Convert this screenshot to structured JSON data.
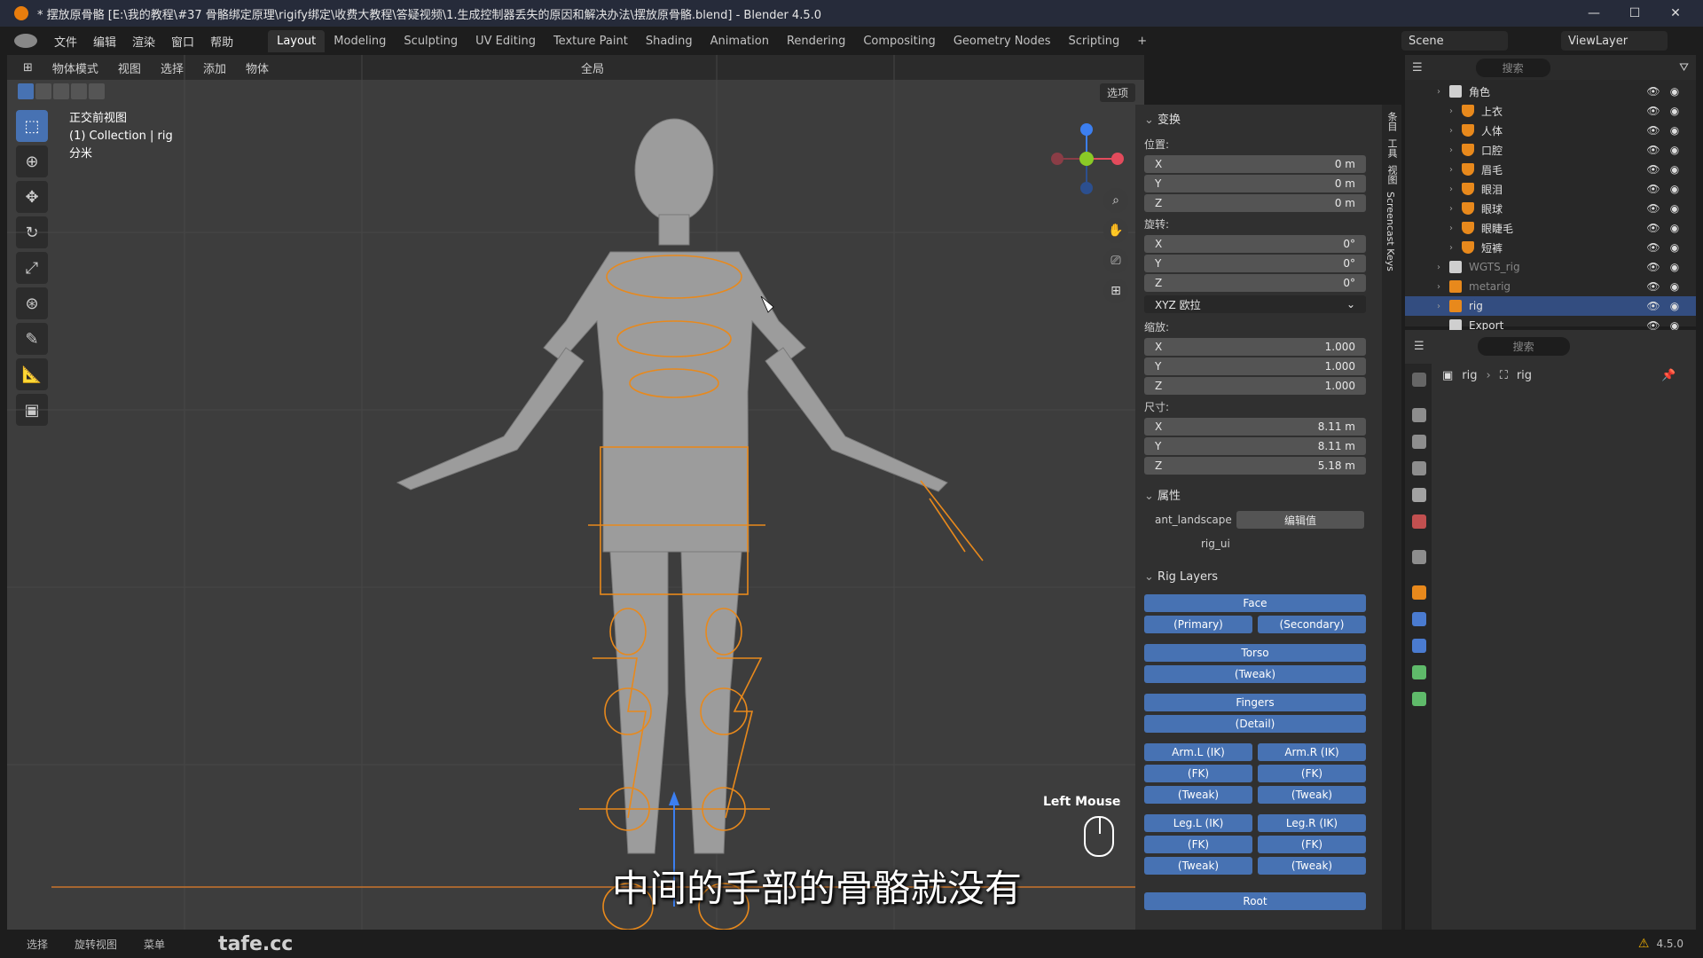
{
  "window": {
    "title": "* 摆放原骨骼 [E:\\我的教程\\#37 骨骼绑定原理\\rigify绑定\\收费大教程\\答疑视频\\1.生成控制器丢失的原因和解决办法\\摆放原骨骼.blend] - Blender 4.5.0",
    "minimize": "—",
    "maximize": "☐",
    "close": "✕"
  },
  "menu": [
    "文件",
    "编辑",
    "渲染",
    "窗口",
    "帮助"
  ],
  "workspaces": [
    "Layout",
    "Modeling",
    "Sculpting",
    "UV Editing",
    "Texture Paint",
    "Shading",
    "Animation",
    "Rendering",
    "Compositing",
    "Geometry Nodes",
    "Scripting"
  ],
  "active_workspace": "Layout",
  "add_workspace": "+",
  "scene": "Scene",
  "view_layer": "ViewLayer",
  "viewport_header": {
    "mode": "物体模式",
    "menus": [
      "视图",
      "选择",
      "添加",
      "物体"
    ],
    "transform_orientation": "全局",
    "options": "选项"
  },
  "viewport_overlay": {
    "view_name": "正交前视图",
    "collection": "(1) Collection | rig",
    "units": "分米"
  },
  "screencast": {
    "key": "Left Mouse"
  },
  "subtitle": "中间的手部的骨骼就没有",
  "npanel": {
    "transform_title": "变换",
    "location_label": "位置:",
    "location": [
      {
        "axis": "X",
        "value": "0 m"
      },
      {
        "axis": "Y",
        "value": "0 m"
      },
      {
        "axis": "Z",
        "value": "0 m"
      }
    ],
    "rotation_label": "旋转:",
    "rotation": [
      {
        "axis": "X",
        "value": "0°"
      },
      {
        "axis": "Y",
        "value": "0°"
      },
      {
        "axis": "Z",
        "value": "0°"
      }
    ],
    "rotation_mode": "XYZ 欧拉",
    "scale_label": "缩放:",
    "scale": [
      {
        "axis": "X",
        "value": "1.000"
      },
      {
        "axis": "Y",
        "value": "1.000"
      },
      {
        "axis": "Z",
        "value": "1.000"
      }
    ],
    "dimensions_label": "尺寸:",
    "dimensions": [
      {
        "axis": "X",
        "value": "8.11 m"
      },
      {
        "axis": "Y",
        "value": "8.11 m"
      },
      {
        "axis": "Z",
        "value": "5.18 m"
      }
    ],
    "properties_title": "属性",
    "prop_name": "ant_landscape",
    "prop_button": "编辑值",
    "prop_rig_ui": "rig_ui",
    "rig_layers_title": "Rig Layers",
    "rig_layers": {
      "face": "Face",
      "primary": "(Primary)",
      "secondary": "(Secondary)",
      "torso": "Torso",
      "torso_tweak": "(Tweak)",
      "fingers": "Fingers",
      "detail": "(Detail)",
      "arm_l_ik": "Arm.L (IK)",
      "arm_r_ik": "Arm.R (IK)",
      "arm_l_fk": "(FK)",
      "arm_r_fk": "(FK)",
      "arm_l_tweak": "(Tweak)",
      "arm_r_tweak": "(Tweak)",
      "leg_l_ik": "Leg.L (IK)",
      "leg_r_ik": "Leg.R (IK)",
      "leg_l_fk": "(FK)",
      "leg_r_fk": "(FK)",
      "leg_l_tweak": "(Tweak)",
      "leg_r_tweak": "(Tweak)",
      "root": "Root"
    },
    "side_tabs": [
      "条目",
      "工具",
      "视图",
      "Screencast Keys"
    ]
  },
  "outliner": {
    "search_placeholder": "搜索",
    "rows": [
      {
        "name": "角色",
        "type": "collection"
      },
      {
        "name": "上衣",
        "type": "mesh"
      },
      {
        "name": "人体",
        "type": "mesh"
      },
      {
        "name": "口腔",
        "type": "mesh"
      },
      {
        "name": "眉毛",
        "type": "mesh"
      },
      {
        "name": "眼泪",
        "type": "mesh"
      },
      {
        "name": "眼球",
        "type": "mesh"
      },
      {
        "name": "眼睫毛",
        "type": "mesh"
      },
      {
        "name": "短裤",
        "type": "mesh"
      },
      {
        "name": "WGTS_rig",
        "type": "collection"
      },
      {
        "name": "metarig",
        "type": "armature"
      },
      {
        "name": "rig",
        "type": "armature"
      },
      {
        "name": "Export",
        "type": "collection"
      }
    ]
  },
  "properties": {
    "search_placeholder": "搜索",
    "breadcrumb_object": "rig",
    "breadcrumb_data": "rig"
  },
  "statusbar": {
    "items": [
      "选择",
      "旋转视图",
      "菜单"
    ],
    "version": "4.5.0"
  },
  "watermark": "tafe.cc",
  "colors": {
    "accent": "#4772b3",
    "rig_orange": "#e8891c",
    "mesh_orange": "#e8891c",
    "armature_green": "#5fba6a"
  }
}
